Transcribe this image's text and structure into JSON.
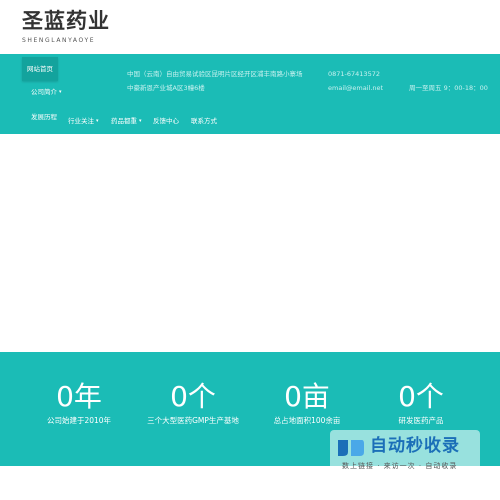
{
  "logo": {
    "name_cn": "圣蓝药业",
    "name_en": "SHENGLANYAOYE"
  },
  "nav": {
    "items": [
      {
        "label": "网站首页",
        "active": true,
        "dropdown": false
      },
      {
        "label": "公司简介",
        "active": false,
        "dropdown": true
      },
      {
        "label": "发展历程",
        "active": false,
        "dropdown": false
      },
      {
        "label": "行业关注",
        "active": false,
        "dropdown": true
      },
      {
        "label": "药品都重",
        "active": false,
        "dropdown": true
      },
      {
        "label": "反馈中心",
        "active": false,
        "dropdown": false
      },
      {
        "label": "联系方式",
        "active": false,
        "dropdown": false
      }
    ],
    "caret": "▾"
  },
  "contact": {
    "address_line1": "中国（云南）自由贸易试验区昆明片区经开区浦丰南路小寨场",
    "address_line2": "中豪新恩产业城A区3幢6楼",
    "phone": "0871-67413572",
    "email": "email@email.net",
    "hours": "周一至周五 9：00-18：00"
  },
  "stats": [
    {
      "number": "0年",
      "label": "公司始建于2010年"
    },
    {
      "number": "0个",
      "label": "三个大型医药GMP生产基地"
    },
    {
      "number": "0亩",
      "label": "总占地面积100余亩"
    },
    {
      "number": "0个",
      "label": "研发医药产品"
    }
  ],
  "watermark": {
    "title": "自动秒收录",
    "subtitle": "数上链接 · 来访一次 · 自动收录"
  },
  "colors": {
    "brand_teal": "#1bbcb6",
    "nav_active": "#13a39d",
    "logo_text": "#333333"
  }
}
